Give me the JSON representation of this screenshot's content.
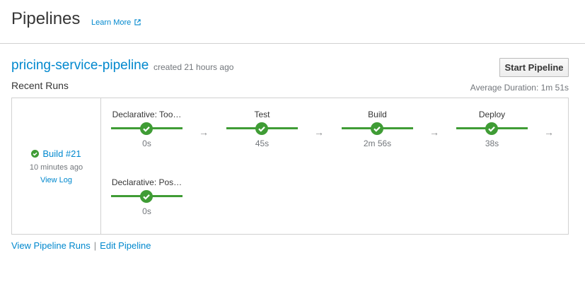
{
  "header": {
    "title": "Pipelines",
    "learn_more": "Learn More"
  },
  "pipeline": {
    "name": "pricing-service-pipeline",
    "created": "created 21 hours ago",
    "start_button": "Start Pipeline",
    "recent_runs_label": "Recent Runs",
    "average_duration": "Average Duration: 1m 51s"
  },
  "run": {
    "build": "Build #21",
    "time": "10 minutes ago",
    "view_log": "View Log",
    "status": "success",
    "stages": [
      {
        "name": "Declarative: Too…",
        "duration": "0s",
        "status": "success"
      },
      {
        "name": "Test",
        "duration": "45s",
        "status": "success"
      },
      {
        "name": "Build",
        "duration": "2m 56s",
        "status": "success"
      },
      {
        "name": "Deploy",
        "duration": "38s",
        "status": "success"
      },
      {
        "name": "Declarative: Pos…",
        "duration": "0s",
        "status": "success"
      }
    ],
    "arrow_glyph": "→"
  },
  "footer": {
    "view_runs": "View Pipeline Runs",
    "separator": "|",
    "edit": "Edit Pipeline"
  },
  "colors": {
    "link": "#0088ce",
    "success": "#3f9c35",
    "muted": "#72767b"
  },
  "icons": {
    "external_link": "external-link-icon",
    "success": "check-circle-icon",
    "arrow": "arrow-right-icon"
  }
}
